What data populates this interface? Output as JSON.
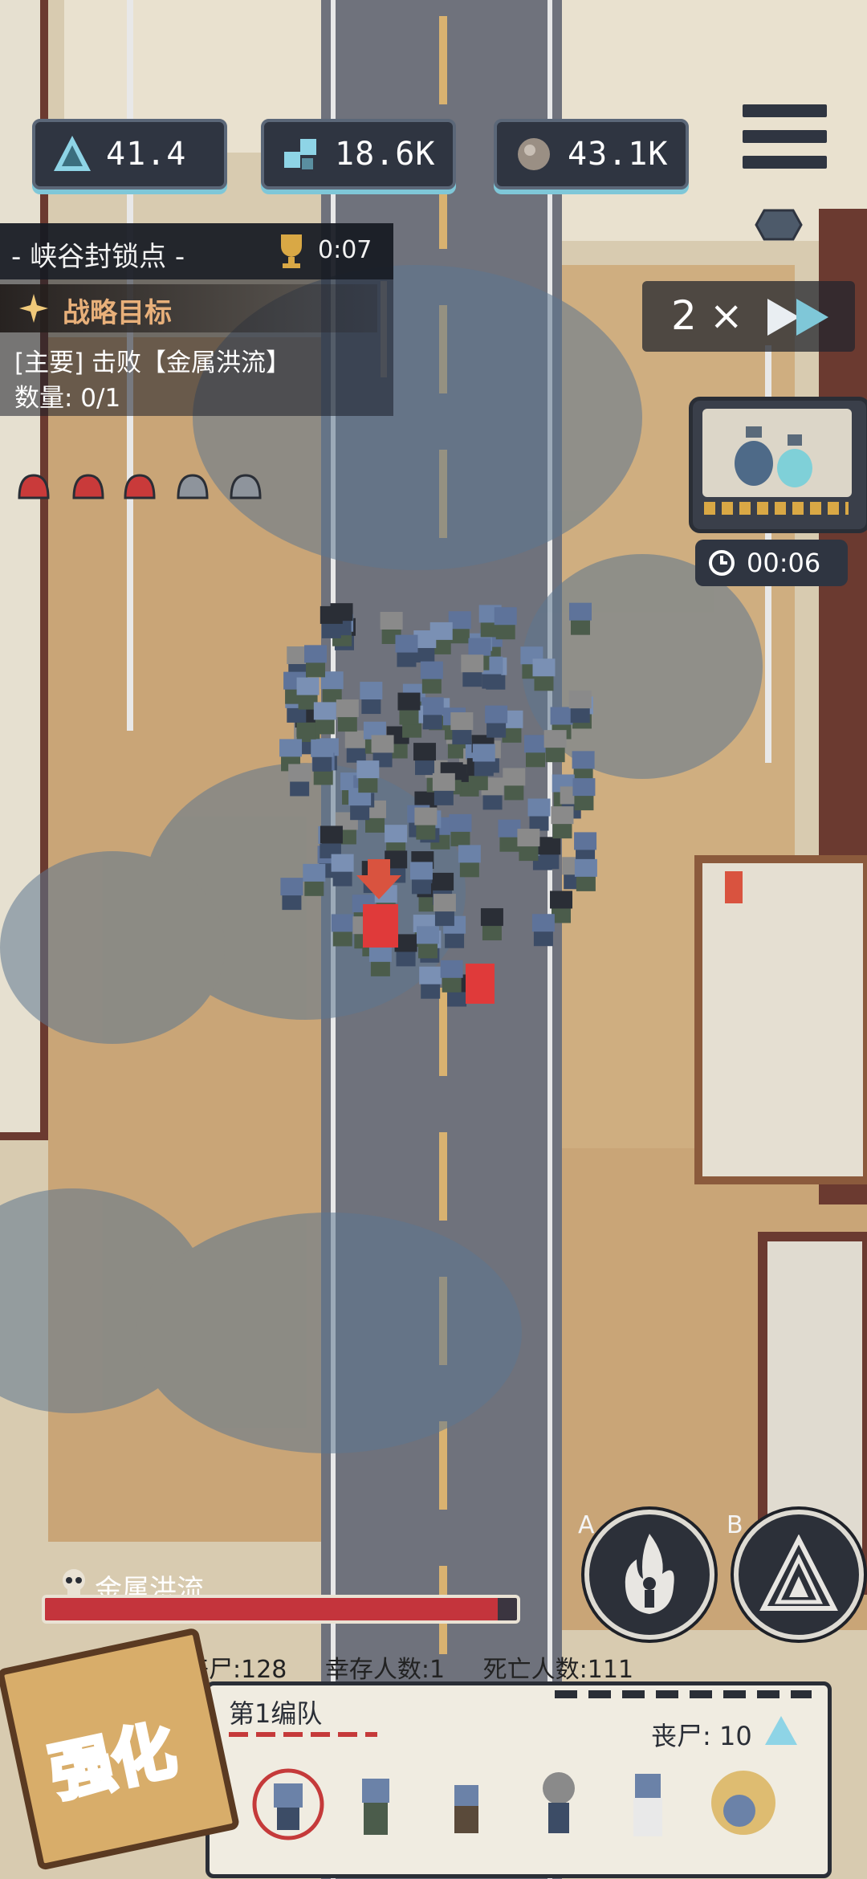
{
  "resources": [
    {
      "icon": "crystal-icon",
      "value": "41.4"
    },
    {
      "icon": "parts-icon",
      "value": "18.6K"
    },
    {
      "icon": "scrap-icon",
      "value": "43.1K"
    }
  ],
  "mission": {
    "title": "- 峡谷封锁点 -",
    "timer": "0:07",
    "objective_label": "战略目标",
    "main_objective": "[主要] 击败【金属洪流】",
    "count": "数量: 0/1"
  },
  "speed": {
    "label": "2 ×"
  },
  "shop": {
    "timer": "00:06"
  },
  "boss": {
    "name": "金属洪流",
    "health_fraction": 0.96
  },
  "skills": [
    {
      "letter": "A",
      "icon": "fire-figure-icon"
    },
    {
      "letter": "B",
      "icon": "triangle-icon"
    }
  ],
  "stats": {
    "zombies": "丧尸:128",
    "survivors": "幸存人数:1",
    "deaths": "死亡人数:111"
  },
  "squad": {
    "tab": "第1编队",
    "zombie_count": "丧尸: 10"
  },
  "strengthen": {
    "label": "强化"
  },
  "colors": {
    "road": "#6f727c",
    "sand": "#c9a577",
    "fog": "#5c7690",
    "panel_dark": "#2f3541",
    "accent_cyan": "#7fc7d8",
    "boss_red": "#c4343c"
  }
}
